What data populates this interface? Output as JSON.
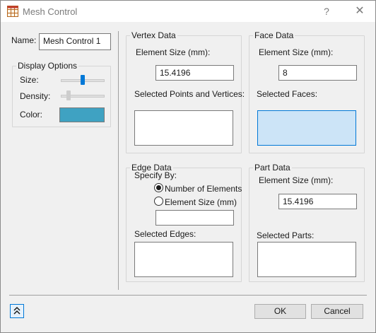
{
  "window": {
    "title": "Mesh Control",
    "help_glyph": "?",
    "close_glyph": "✕",
    "app_icon": "grid-app-icon"
  },
  "name": {
    "label": "Name:",
    "value": "Mesh Control 1"
  },
  "display_options": {
    "title": "Display Options",
    "size_label": "Size:",
    "density_label": "Density:",
    "color_label": "Color:",
    "size_level": 0.5,
    "density_level": 0.15,
    "color_value": "#3fa2c2"
  },
  "vertex_data": {
    "title": "Vertex Data",
    "element_size_label": "Element Size (mm):",
    "element_size_value": "15.4196",
    "selected_label": "Selected Points and Vertices:"
  },
  "face_data": {
    "title": "Face Data",
    "element_size_label": "Element Size (mm):",
    "element_size_value": "8",
    "selected_label": "Selected Faces:"
  },
  "edge_data": {
    "title": "Edge Data",
    "specify_by_label": "Specify By:",
    "option_number": "Number of Elements",
    "option_size": "Element Size (mm)",
    "selected_option": "Number of Elements",
    "input_value": "",
    "selected_label": "Selected Edges:"
  },
  "part_data": {
    "title": "Part Data",
    "element_size_label": "Element Size (mm):",
    "element_size_value": "15.4196",
    "selected_label": "Selected Parts:"
  },
  "footer": {
    "expand_icon": "double-chevron-up-icon",
    "ok_label": "OK",
    "cancel_label": "Cancel"
  },
  "colors": {
    "active_thumb": "#0078d7",
    "disabled_thumb": "#cdcdcd",
    "face_selection_fill": "#cce4f7",
    "face_selection_border": "#0078d7"
  }
}
